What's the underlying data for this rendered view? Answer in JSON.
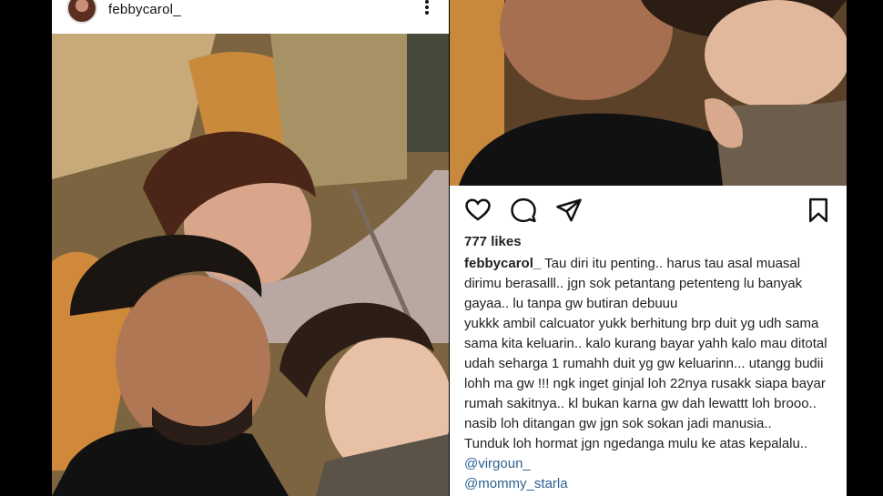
{
  "post": {
    "username": "febbycarol_",
    "likes": "777 likes",
    "caption_user": "febbycarol_",
    "caption_lines": [
      "Tau diri itu penting.. harus tau asal muasal dirimu berasalll.. jgn sok petantang petenteng lu banyak gayaa.. lu tanpa gw butiran debuuu",
      "yukkk ambil calcuator yukk berhitung brp duit yg udh sama sama kita keluarin.. kalo kurang bayar yahh kalo mau ditotal udah seharga 1 rumahh duit yg gw keluarinn... utangg budii lohh ma gw !!! ngk inget ginjal loh 22nya rusakk siapa bayar rumah sakitnya.. kl bukan karna gw dah lewattt loh brooo.. nasib loh ditangan gw jgn sok sokan jadi manusia..",
      "Tunduk loh hormat jgn ngedanga mulu ke atas kepalalu.."
    ],
    "mentions": [
      "@virgoun_",
      "@mommy_starla"
    ]
  },
  "icons": {
    "like": "heart-icon",
    "comment": "comment-icon",
    "share": "send-icon",
    "save": "bookmark-icon",
    "more": "more-vertical-icon"
  },
  "colors": {
    "mention": "#2b5f8f",
    "text": "#222222",
    "background": "#000000"
  }
}
